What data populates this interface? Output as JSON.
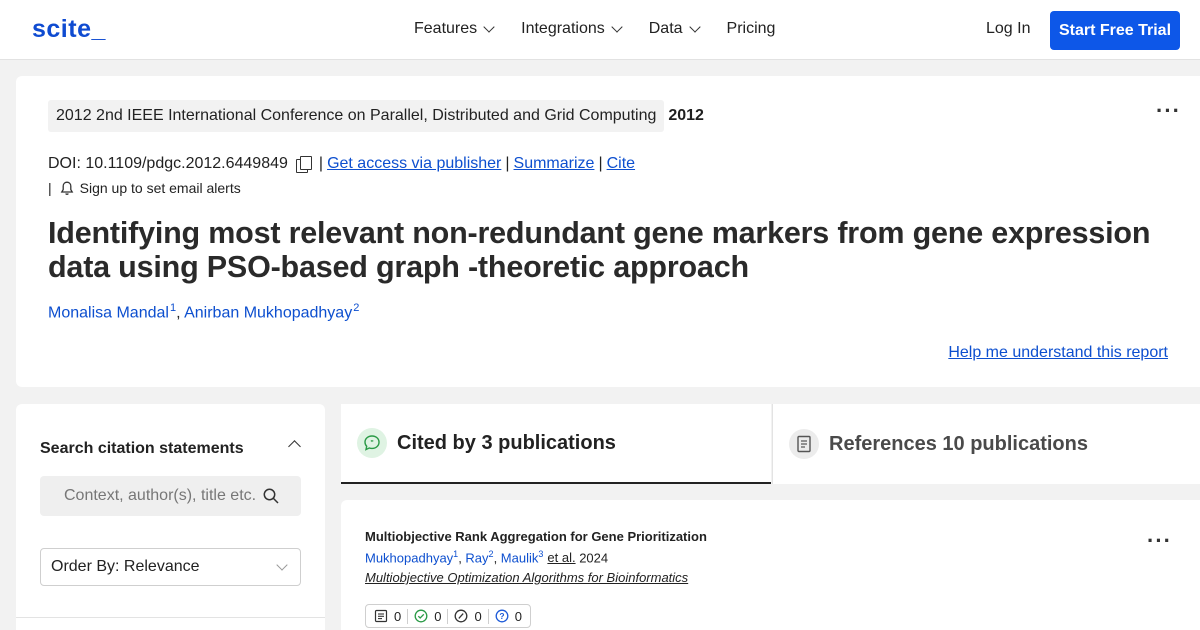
{
  "nav": {
    "logo": "scite_",
    "links": [
      {
        "label": "Features",
        "dropdown": true
      },
      {
        "label": "Integrations",
        "dropdown": true
      },
      {
        "label": "Data",
        "dropdown": true
      },
      {
        "label": "Pricing",
        "dropdown": false
      }
    ],
    "login": "Log In",
    "cta": "Start Free Trial"
  },
  "paper": {
    "venue": "2012 2nd IEEE International Conference on Parallel, Distributed and Grid Computing",
    "year": "2012",
    "more_icon": "more-horizontal-icon",
    "doi": "DOI: 10.1109/pdgc.2012.6449849",
    "copy_icon": "copy-icon",
    "sep": "|",
    "actions": {
      "access": "Get access via publisher",
      "summarize": "Summarize",
      "cite": "Cite"
    },
    "alert_text": "Sign up to set email alerts",
    "bell_icon": "bell-icon",
    "title": "Identifying most relevant non-redundant gene markers from gene expression data using PSO-based graph -theoretic approach",
    "authors": [
      {
        "name": "Monalisa Mandal",
        "sup": "1"
      },
      {
        "name": "Anirban Mukhopadhyay",
        "sup": "2"
      }
    ],
    "author_sep": ", ",
    "help_link": "Help me understand this report"
  },
  "sidebar": {
    "heading": "Search citation statements",
    "search_placeholder": "Context, author(s), title etc.",
    "order_by": "Order By: Relevance"
  },
  "tabs": {
    "cited": "Cited by 3 publications",
    "references": "References 10 publications"
  },
  "result": {
    "title": "Multiobjective Rank Aggregation for Gene Prioritization",
    "authors": [
      {
        "name": "Mukhopadhyay",
        "sup": "1"
      },
      {
        "name": "Ray",
        "sup": "2"
      },
      {
        "name": "Maulik",
        "sup": "3"
      }
    ],
    "et_al": "et al.",
    "year": "2024",
    "journal": "Multiobjective Optimization Algorithms for Bioinformatics",
    "stats": {
      "total": "0",
      "supporting": "0",
      "mentioning": "0",
      "contrasting": "0"
    }
  },
  "colors": {
    "brand": "#0f4bd1",
    "cta": "#0d57e8",
    "link": "#0d4fcf",
    "supporting": "#2a9a46",
    "contrasting": "#1d5ad8"
  }
}
